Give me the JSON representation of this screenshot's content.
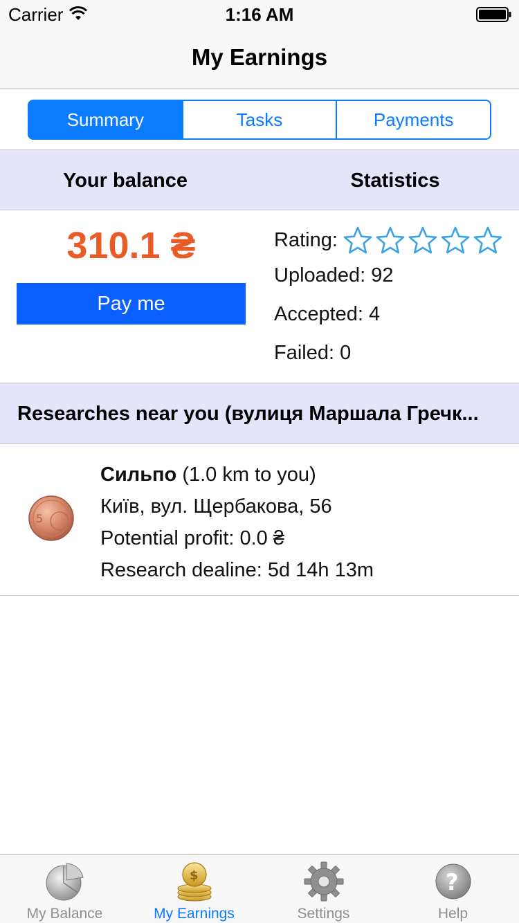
{
  "status_bar": {
    "carrier": "Carrier",
    "time": "1:16 AM"
  },
  "nav": {
    "title": "My Earnings"
  },
  "segments": [
    {
      "label": "Summary",
      "active": true
    },
    {
      "label": "Tasks",
      "active": false
    },
    {
      "label": "Payments",
      "active": false
    }
  ],
  "summary_header": {
    "balance": "Your balance",
    "statistics": "Statistics"
  },
  "balance": {
    "amount": "310.1 ₴",
    "pay_button": "Pay me"
  },
  "stats": {
    "rating_label": "Rating:",
    "rating_stars": 0,
    "rating_max": 5,
    "uploaded": "Uploaded: 92",
    "accepted": "Accepted: 4",
    "failed": "Failed: 0"
  },
  "researches": {
    "header": "Researches near you (вулиця Маршала Гречк...",
    "items": [
      {
        "name": "Сильпо",
        "distance": " (1.0 km to you)",
        "address": "Київ, вул. Щербакова, 56",
        "profit": "Potential profit: 0.0 ₴",
        "deadline": "Research dealine: 5d 14h 13m",
        "icon": "coin-icon"
      }
    ]
  },
  "tabs": [
    {
      "label": "My Balance",
      "icon": "pie-chart-icon",
      "active": false
    },
    {
      "label": "My Earnings",
      "icon": "coins-icon",
      "active": true
    },
    {
      "label": "Settings",
      "icon": "gear-icon",
      "active": false
    },
    {
      "label": "Help",
      "icon": "help-icon",
      "active": false
    }
  ],
  "colors": {
    "accent": "#0b7bff",
    "pay_button": "#0b5fff",
    "balance": "#e95c26",
    "section_header": "#e4e4fb",
    "star": "#3aa3e8"
  }
}
